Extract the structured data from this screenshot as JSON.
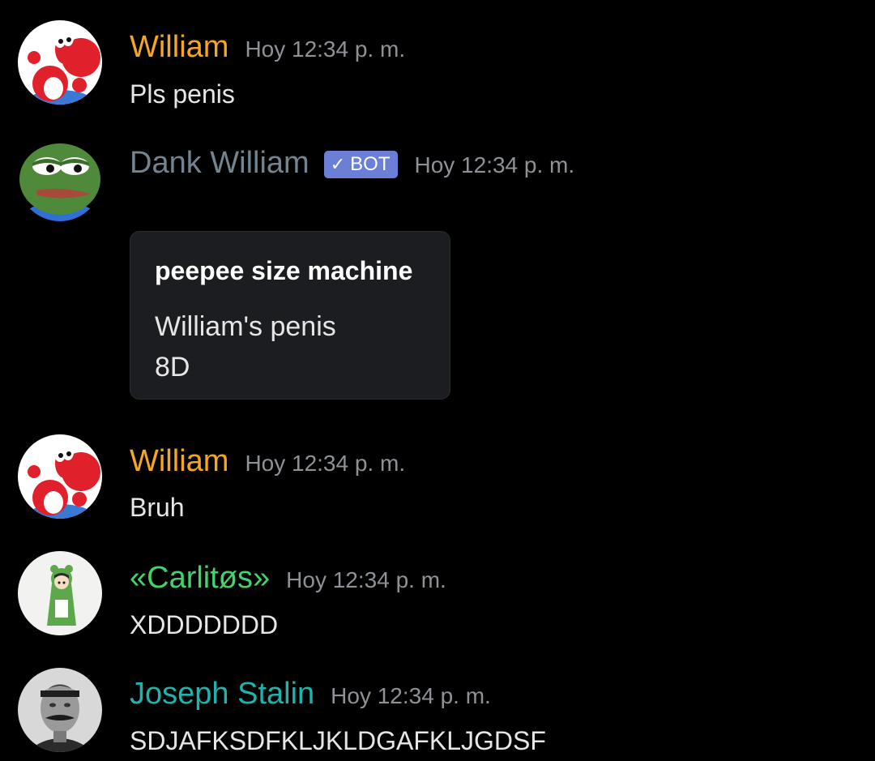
{
  "colors": {
    "background": "#000000",
    "william": "#f5a623",
    "dank_william": "#74838f",
    "carlitos": "#43d36b",
    "stalin": "#1fb3ae",
    "timestamp": "#8e9297",
    "bot_badge": "#6b7fd7"
  },
  "messages": [
    {
      "username": "William",
      "timestamp": "Hoy 12:34 p. m.",
      "text": "Pls penis",
      "avatar": "red-yoshi-avatar"
    },
    {
      "username": "Dank William",
      "badge": "BOT",
      "badge_check": "✓",
      "timestamp": "Hoy 12:34 p. m.",
      "avatar": "pepe-avatar",
      "embed": {
        "title": "peepee size machine",
        "line1": "William's penis",
        "line2": "8D"
      }
    },
    {
      "username": "William",
      "timestamp": "Hoy 12:34 p. m.",
      "text": "Bruh",
      "avatar": "red-yoshi-avatar"
    },
    {
      "username": "«Carlitøs»",
      "timestamp": "Hoy 12:34 p. m.",
      "text": "XDDDDDDD",
      "avatar": "frog-hoodie-avatar"
    },
    {
      "username": "Joseph Stalin",
      "timestamp": "Hoy 12:34 p. m.",
      "text": "SDJAFKSDFKLJKLDGAFKLJGDSF",
      "avatar": "stalin-portrait-avatar"
    }
  ]
}
